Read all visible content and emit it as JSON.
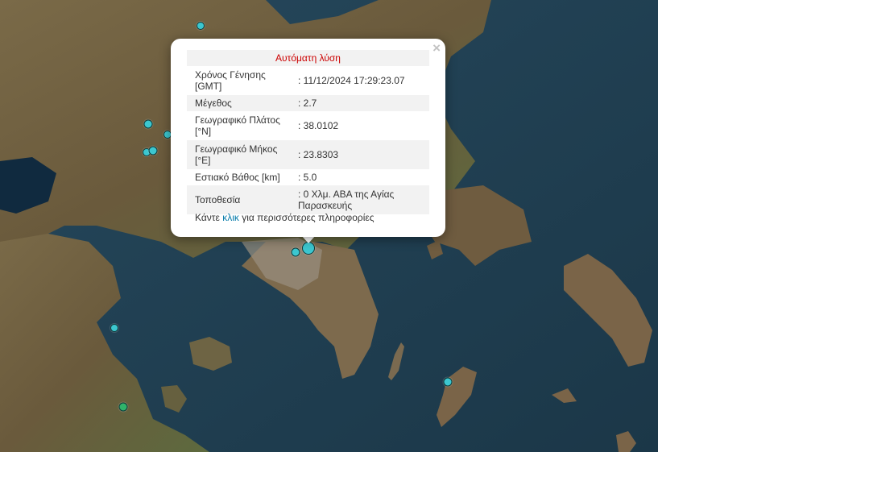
{
  "popup": {
    "close": "×",
    "title": "Αυτόματη λύση",
    "rows": [
      {
        "label": "Χρόνος Γένησης [GMT]",
        "value": ": 11/12/2024 17:29:23.07"
      },
      {
        "label": "Μέγεθος",
        "value": ": 2.7"
      },
      {
        "label": "Γεωγραφικό Πλάτος [°N]",
        "value": ": 38.0102"
      },
      {
        "label": "Γεωγραφικό Μήκος [°E]",
        "value": ": 23.8303"
      },
      {
        "label": "Εστιακό Βάθος [km]",
        "value": ": 5.0"
      },
      {
        "label": "Τοποθεσία",
        "value": ": 0 Χλμ. ΑΒΑ της Αγίας Παρασκευής"
      }
    ],
    "footer_pre": "Κάντε ",
    "footer_link": "κλικ",
    "footer_post": " για περισσότερες πληροφορίες"
  },
  "colors": {
    "sea": "#1f3f55",
    "land": "#6b5a3e",
    "marker_cyan": "#3cc7d0",
    "marker_green": "#2fb36a",
    "title_red": "#cc0000",
    "link_blue": "#0078a8"
  }
}
